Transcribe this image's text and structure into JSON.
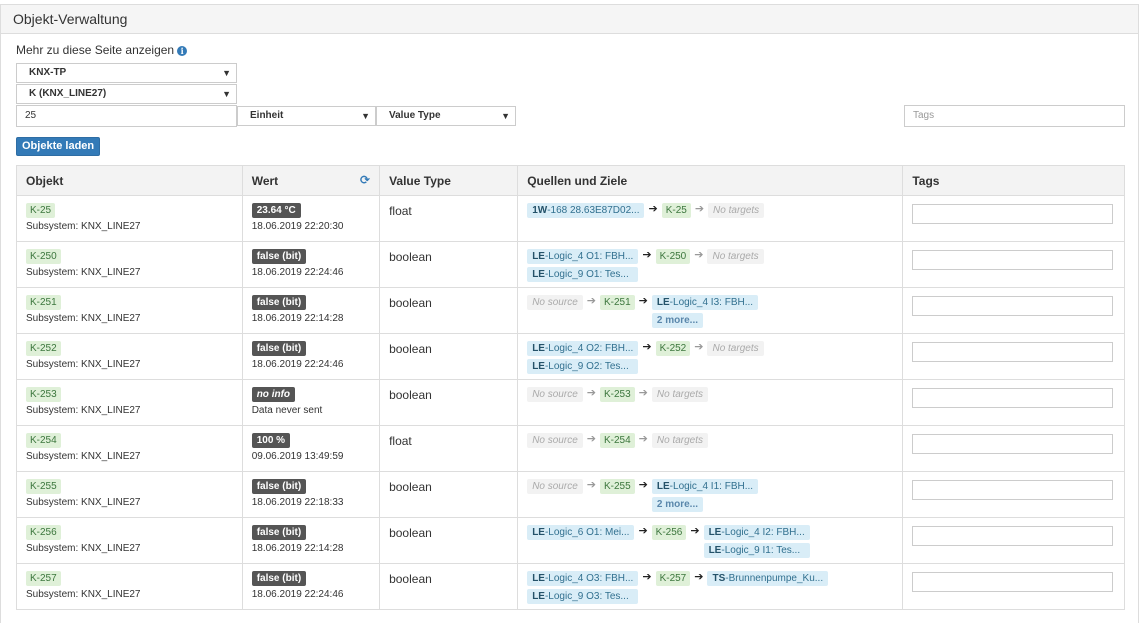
{
  "panel": {
    "title": "Objekt-Verwaltung"
  },
  "filters": {
    "more_label": "Mehr zu diese Seite anzeigen",
    "info_icon": "i",
    "bus_select": "KNX-TP",
    "line_select": "K (KNX_LINE27)",
    "count_input": "25",
    "unit_select": "Einheit",
    "valuetype_select": "Value Type",
    "tags_placeholder": "Tags",
    "load_button": "Objekte laden"
  },
  "table": {
    "headers": {
      "objekt": "Objekt",
      "wert": "Wert",
      "value_type": "Value Type",
      "quellen": "Quellen und Ziele",
      "tags": "Tags"
    },
    "rows": [
      {
        "name": "K-25",
        "subsystem": "Subsystem: KNX_LINE27",
        "value": "23.64 °C",
        "time": "18.06.2019 22:20:30",
        "type": "float",
        "sources": [
          {
            "prefix": "1W",
            "text": "-168 28.63E87D02..."
          }
        ],
        "targets": [],
        "no_source": "",
        "no_targets": "No targets",
        "more": ""
      },
      {
        "name": "K-250",
        "subsystem": "Subsystem: KNX_LINE27",
        "value": "false (bit)",
        "time": "18.06.2019 22:24:46",
        "type": "boolean",
        "sources": [
          {
            "prefix": "LE",
            "text": "-Logic_4 O1: FBH..."
          },
          {
            "prefix": "LE",
            "text": "-Logic_9 O1: Tes..."
          }
        ],
        "targets": [],
        "no_source": "",
        "no_targets": "No targets",
        "more": ""
      },
      {
        "name": "K-251",
        "subsystem": "Subsystem: KNX_LINE27",
        "value": "false (bit)",
        "time": "18.06.2019 22:14:28",
        "type": "boolean",
        "sources": [],
        "targets": [
          {
            "prefix": "LE",
            "text": "-Logic_4 I3: FBH..."
          }
        ],
        "no_source": "No source",
        "no_targets": "",
        "more": "2 more..."
      },
      {
        "name": "K-252",
        "subsystem": "Subsystem: KNX_LINE27",
        "value": "false (bit)",
        "time": "18.06.2019 22:24:46",
        "type": "boolean",
        "sources": [
          {
            "prefix": "LE",
            "text": "-Logic_4 O2: FBH..."
          },
          {
            "prefix": "LE",
            "text": "-Logic_9 O2: Tes..."
          }
        ],
        "targets": [],
        "no_source": "",
        "no_targets": "No targets",
        "more": ""
      },
      {
        "name": "K-253",
        "subsystem": "Subsystem: KNX_LINE27",
        "value": "no info",
        "time": "Data never sent",
        "type": "boolean",
        "sources": [],
        "targets": [],
        "no_source": "No source",
        "no_targets": "No targets",
        "more": ""
      },
      {
        "name": "K-254",
        "subsystem": "Subsystem: KNX_LINE27",
        "value": "100 %",
        "time": "09.06.2019 13:49:59",
        "type": "float",
        "sources": [],
        "targets": [],
        "no_source": "No source",
        "no_targets": "No targets",
        "more": ""
      },
      {
        "name": "K-255",
        "subsystem": "Subsystem: KNX_LINE27",
        "value": "false (bit)",
        "time": "18.06.2019 22:18:33",
        "type": "boolean",
        "sources": [],
        "targets": [
          {
            "prefix": "LE",
            "text": "-Logic_4 I1: FBH..."
          }
        ],
        "no_source": "No source",
        "no_targets": "",
        "more": "2 more..."
      },
      {
        "name": "K-256",
        "subsystem": "Subsystem: KNX_LINE27",
        "value": "false (bit)",
        "time": "18.06.2019 22:14:28",
        "type": "boolean",
        "sources": [
          {
            "prefix": "LE",
            "text": "-Logic_6 O1: Mei..."
          }
        ],
        "targets": [
          {
            "prefix": "LE",
            "text": "-Logic_4 I2: FBH..."
          },
          {
            "prefix": "LE",
            "text": "-Logic_9 I1: Tes..."
          }
        ],
        "no_source": "",
        "no_targets": "",
        "more": ""
      },
      {
        "name": "K-257",
        "subsystem": "Subsystem: KNX_LINE27",
        "value": "false (bit)",
        "time": "18.06.2019 22:24:46",
        "type": "boolean",
        "sources": [
          {
            "prefix": "LE",
            "text": "-Logic_4 O3: FBH..."
          },
          {
            "prefix": "LE",
            "text": "-Logic_9 O3: Tes..."
          }
        ],
        "targets": [
          {
            "prefix": "TS",
            "text": "-Brunnenpumpe_Ku..."
          }
        ],
        "no_source": "",
        "no_targets": "",
        "more": ""
      }
    ]
  },
  "colors": {
    "accent": "#337ab7",
    "object_tag_bg": "#dff0d8",
    "link_tag_bg": "#d9edf7",
    "value_bg": "#555555"
  },
  "icons": {
    "refresh": "refresh-icon",
    "info": "info-circle-icon",
    "caret": "caret-down-icon",
    "arrow": "arrow-right-icon"
  }
}
